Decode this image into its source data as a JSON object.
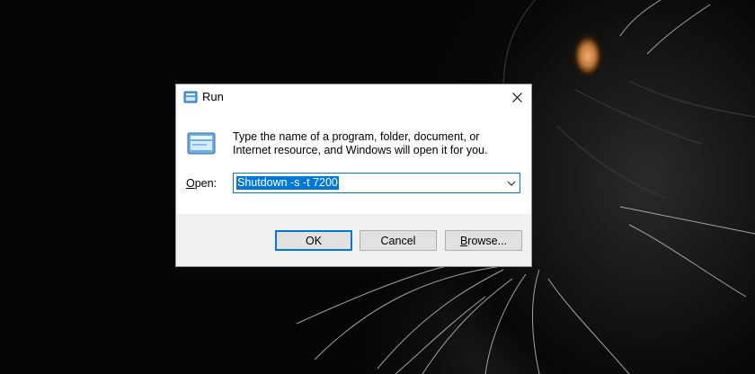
{
  "window": {
    "title": "Run",
    "icon": "run-icon",
    "close_icon": "close-icon"
  },
  "dialog": {
    "description": "Type the name of a program, folder, document, or Internet resource, and Windows will open it for you.",
    "open_label_accel": "O",
    "open_label_rest": "pen:",
    "command_value": "Shutdown -s -t 7200",
    "dropdown_icon": "chevron-down-icon"
  },
  "buttons": {
    "ok": "OK",
    "cancel": "Cancel",
    "browse_accel": "B",
    "browse_rest": "rowse..."
  },
  "colors": {
    "accent": "#0078d7",
    "footer": "#f0f0f0",
    "button": "#e1e1e1"
  }
}
